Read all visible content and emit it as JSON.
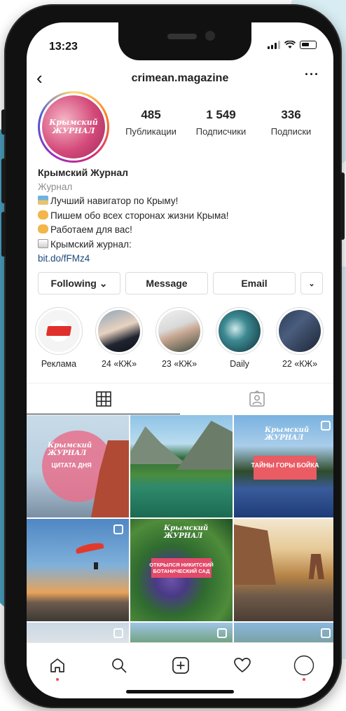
{
  "status_bar": {
    "time": "13:23"
  },
  "header": {
    "back": "‹",
    "username": "crimean.magazine",
    "more": "···"
  },
  "profile": {
    "avatar_text": "Крымский ЖУРНАЛ",
    "stats": [
      {
        "value": "485",
        "label": "Публикации"
      },
      {
        "value": "1 549",
        "label": "Подписчики"
      },
      {
        "value": "336",
        "label": "Подписки"
      }
    ],
    "name": "Крымский Журнал",
    "category": "Журнал",
    "bio_lines": [
      "Лучший навигатор по Крыму!",
      "Пишем обо всех сторонах жизни Крыма!",
      "Работаем для вас!",
      "Крымский журнал:"
    ],
    "link": "bit.do/fFMz4"
  },
  "actions": {
    "following": "Following ⌄",
    "message": "Message",
    "email": "Email",
    "dropdown": "⌄"
  },
  "highlights": [
    {
      "label": "Реклама"
    },
    {
      "label": "24 «КЖ»"
    },
    {
      "label": "23 «КЖ»"
    },
    {
      "label": "Daily"
    },
    {
      "label": "22 «КЖ»"
    }
  ],
  "posts": [
    {
      "caption": "ЦИТАТА ДНЯ",
      "brand": "Крымский ЖУРНАЛ"
    },
    {
      "caption": ""
    },
    {
      "caption": "ТАЙНЫ ГОРЫ БОЙКА",
      "brand": "Крымский ЖУРНАЛ"
    },
    {
      "caption": ""
    },
    {
      "caption": "ОТКРЫЛСЯ НИКИТСКИЙ\nБОТАНИЧЕСКИЙ САД",
      "brand": "Крымский ЖУРНАЛ"
    },
    {
      "caption": ""
    },
    {
      "caption": ""
    },
    {
      "caption": ""
    },
    {
      "caption": ""
    }
  ],
  "colors": {
    "link": "#1c4a7a",
    "story_ring": "#d62976",
    "notification": "#ed4956"
  }
}
